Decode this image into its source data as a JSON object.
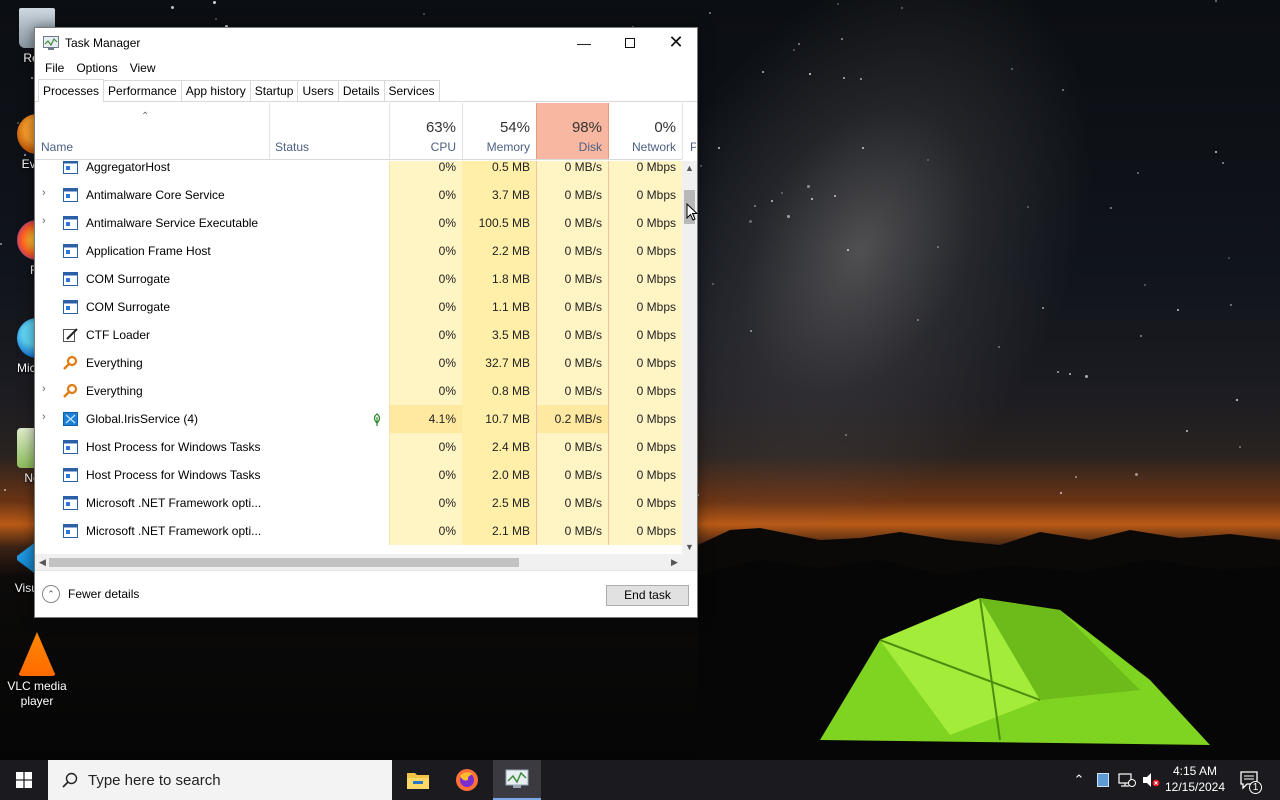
{
  "desktop": {
    "icons": [
      {
        "label": "Recy",
        "name": "recycle-bin-icon"
      },
      {
        "label": "Every",
        "name": "everything-shortcut-icon"
      },
      {
        "label": "Fir",
        "name": "firefox-shortcut-icon"
      },
      {
        "label": "Micr Ec",
        "name": "edge-shortcut-icon"
      },
      {
        "label": "Note",
        "name": "notepad-shortcut-icon"
      },
      {
        "label": "Visual C",
        "name": "vscode-shortcut-icon"
      },
      {
        "label": "VLC media player",
        "name": "vlc-shortcut-icon"
      }
    ]
  },
  "window": {
    "title": "Task Manager",
    "menu": [
      "File",
      "Options",
      "View"
    ],
    "tabs": [
      "Processes",
      "Performance",
      "App history",
      "Startup",
      "Users",
      "Details",
      "Services"
    ],
    "active_tab": "Processes",
    "columns": {
      "name": "Name",
      "status": "Status",
      "cpu": {
        "pct": "63%",
        "label": "CPU"
      },
      "memory": {
        "pct": "54%",
        "label": "Memory"
      },
      "disk": {
        "pct": "98%",
        "label": "Disk"
      },
      "network": {
        "pct": "0%",
        "label": "Network"
      },
      "power": "P"
    },
    "processes": [
      {
        "name": "AggregatorHost",
        "expandable": false,
        "icon": "app-window-icon",
        "status": "",
        "cpu": "0%",
        "memory": "0.5 MB",
        "disk": "0 MB/s",
        "network": "0 Mbps"
      },
      {
        "name": "Antimalware Core Service",
        "expandable": true,
        "icon": "app-window-icon",
        "status": "",
        "cpu": "0%",
        "memory": "3.7 MB",
        "disk": "0 MB/s",
        "network": "0 Mbps"
      },
      {
        "name": "Antimalware Service Executable",
        "expandable": true,
        "icon": "app-window-icon",
        "status": "",
        "cpu": "0%",
        "memory": "100.5 MB",
        "disk": "0 MB/s",
        "network": "0 Mbps"
      },
      {
        "name": "Application Frame Host",
        "expandable": false,
        "icon": "app-window-icon",
        "status": "",
        "cpu": "0%",
        "memory": "2.2 MB",
        "disk": "0 MB/s",
        "network": "0 Mbps"
      },
      {
        "name": "COM Surrogate",
        "expandable": false,
        "icon": "app-window-icon",
        "status": "",
        "cpu": "0%",
        "memory": "1.8 MB",
        "disk": "0 MB/s",
        "network": "0 Mbps"
      },
      {
        "name": "COM Surrogate",
        "expandable": false,
        "icon": "app-window-icon",
        "status": "",
        "cpu": "0%",
        "memory": "1.1 MB",
        "disk": "0 MB/s",
        "network": "0 Mbps"
      },
      {
        "name": "CTF Loader",
        "expandable": false,
        "icon": "ctf-loader-icon",
        "status": "",
        "cpu": "0%",
        "memory": "3.5 MB",
        "disk": "0 MB/s",
        "network": "0 Mbps"
      },
      {
        "name": "Everything",
        "expandable": false,
        "icon": "everything-search-icon",
        "status": "",
        "cpu": "0%",
        "memory": "32.7 MB",
        "disk": "0 MB/s",
        "network": "0 Mbps"
      },
      {
        "name": "Everything",
        "expandable": true,
        "icon": "everything-search-icon",
        "status": "",
        "cpu": "0%",
        "memory": "0.8 MB",
        "disk": "0 MB/s",
        "network": "0 Mbps"
      },
      {
        "name": "Global.IrisService (4)",
        "expandable": true,
        "icon": "iris-service-icon",
        "status": "leaf",
        "cpu": "4.1%",
        "memory": "10.7 MB",
        "disk": "0.2 MB/s",
        "network": "0 Mbps"
      },
      {
        "name": "Host Process for Windows Tasks",
        "expandable": false,
        "icon": "app-window-icon",
        "status": "",
        "cpu": "0%",
        "memory": "2.4 MB",
        "disk": "0 MB/s",
        "network": "0 Mbps"
      },
      {
        "name": "Host Process for Windows Tasks",
        "expandable": false,
        "icon": "app-window-icon",
        "status": "",
        "cpu": "0%",
        "memory": "2.0 MB",
        "disk": "0 MB/s",
        "network": "0 Mbps"
      },
      {
        "name": "Microsoft .NET Framework opti...",
        "expandable": false,
        "icon": "app-window-icon",
        "status": "",
        "cpu": "0%",
        "memory": "2.5 MB",
        "disk": "0 MB/s",
        "network": "0 Mbps"
      },
      {
        "name": "Microsoft .NET Framework opti...",
        "expandable": false,
        "icon": "app-window-icon",
        "status": "",
        "cpu": "0%",
        "memory": "2.1 MB",
        "disk": "0 MB/s",
        "network": "0 Mbps"
      }
    ],
    "footer": {
      "fewer_details": "Fewer details",
      "end_task": "End task"
    }
  },
  "taskbar": {
    "search_placeholder": "Type here to search",
    "clock_time": "4:15 AM",
    "clock_date": "12/15/2024",
    "notification_count": "1"
  },
  "colors": {
    "disk_header": "#f7b7a0",
    "heat_light": "#fff4c4",
    "heat_mid": "#ffefa8"
  }
}
